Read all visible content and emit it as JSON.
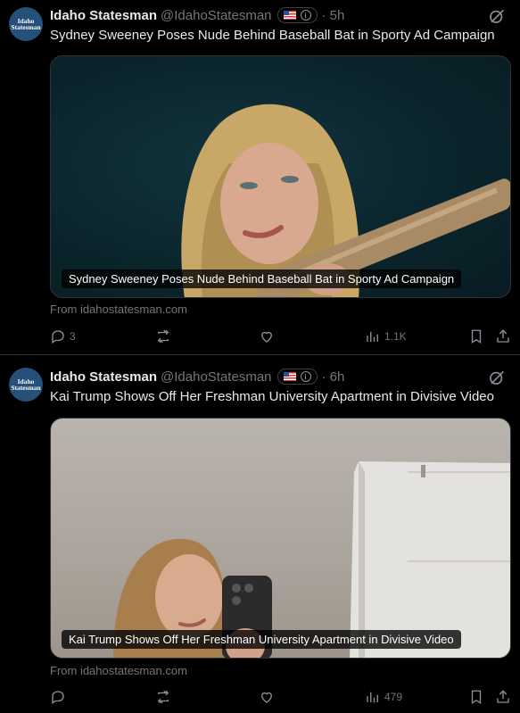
{
  "tweets": [
    {
      "avatar_text": [
        "Idaho",
        "Statesman"
      ],
      "name": "Idaho Statesman",
      "handle": "@IdahoStatesman",
      "badge_info": "i",
      "time": "· 5h",
      "text": "Sydney Sweeney Poses Nude Behind Baseball Bat in Sporty Ad Campaign",
      "media_caption": "Sydney Sweeney Poses Nude Behind Baseball Bat in Sporty Ad Campaign",
      "source": "From idahostatesman.com",
      "replies": "3",
      "reposts": "",
      "likes": "",
      "views": "1.1K"
    },
    {
      "avatar_text": [
        "Idaho",
        "Statesman"
      ],
      "name": "Idaho Statesman",
      "handle": "@IdahoStatesman",
      "badge_info": "i",
      "time": "· 6h",
      "text": "Kai Trump Shows Off Her Freshman University Apartment in Divisive Video",
      "media_caption": "Kai Trump Shows Off Her Freshman University Apartment in Divisive Video",
      "source": "From idahostatesman.com",
      "replies": "",
      "reposts": "",
      "likes": "",
      "views": "479"
    }
  ],
  "icons": {
    "grok": "grok-icon",
    "reply": "reply-icon",
    "repost": "repost-icon",
    "like": "like-icon",
    "views": "views-icon",
    "bookmark": "bookmark-icon",
    "share": "share-icon",
    "flag": "us-flag-icon"
  },
  "colors": {
    "background": "#000000",
    "text": "#e7e9ea",
    "muted": "#71767b",
    "avatar": "#25507a",
    "divider": "#2f3336"
  }
}
